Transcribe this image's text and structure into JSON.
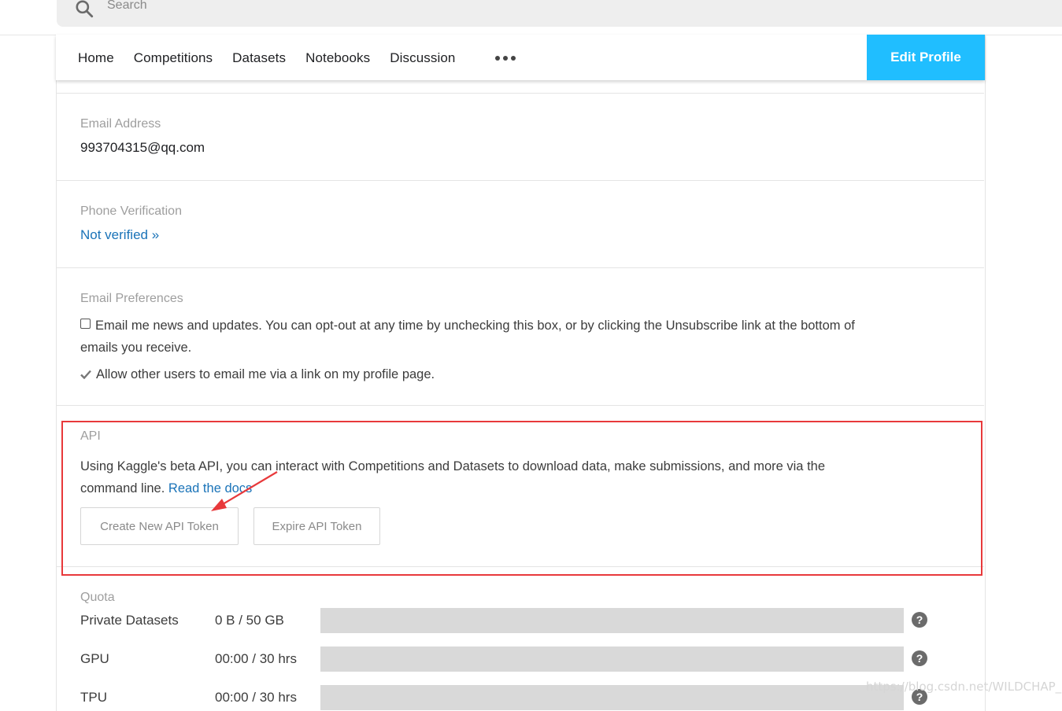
{
  "search": {
    "placeholder": "Search"
  },
  "nav": {
    "items": [
      "Home",
      "Competitions",
      "Datasets",
      "Notebooks",
      "Discussion"
    ],
    "edit_profile": "Edit Profile"
  },
  "email": {
    "label": "Email Address",
    "value": "993704315@qq.com"
  },
  "phone": {
    "label": "Phone Verification",
    "status": "Not verified »"
  },
  "preferences": {
    "label": "Email Preferences",
    "news_line1": "Email me news and updates. You can opt-out at any time by unchecking this box, or by clicking the Unsubscribe link at the bottom of",
    "news_line2": "emails you receive.",
    "allow": "Allow other users to email me via a link on my profile page."
  },
  "api": {
    "label": "API",
    "desc_line1": "Using Kaggle's beta API, you can interact with Competitions and Datasets to download data, make submissions, and more via the",
    "desc_line2": "command line.",
    "docs_link": "Read the docs",
    "create_button": "Create New API Token",
    "expire_button": "Expire API Token"
  },
  "quota": {
    "label": "Quota",
    "rows": [
      {
        "name": "Private Datasets",
        "value": "0 B / 50 GB",
        "used_fraction": 0
      },
      {
        "name": "GPU",
        "value": "00:00 / 30 hrs",
        "used_fraction": 0
      },
      {
        "name": "TPU",
        "value": "00:00 / 30 hrs",
        "used_fraction": 0
      }
    ]
  },
  "watermark": "https://blog.csdn.net/WILDCHAP_",
  "colors": {
    "accent": "#20beff",
    "link": "#1a73b8",
    "highlight": "#e8393b"
  }
}
